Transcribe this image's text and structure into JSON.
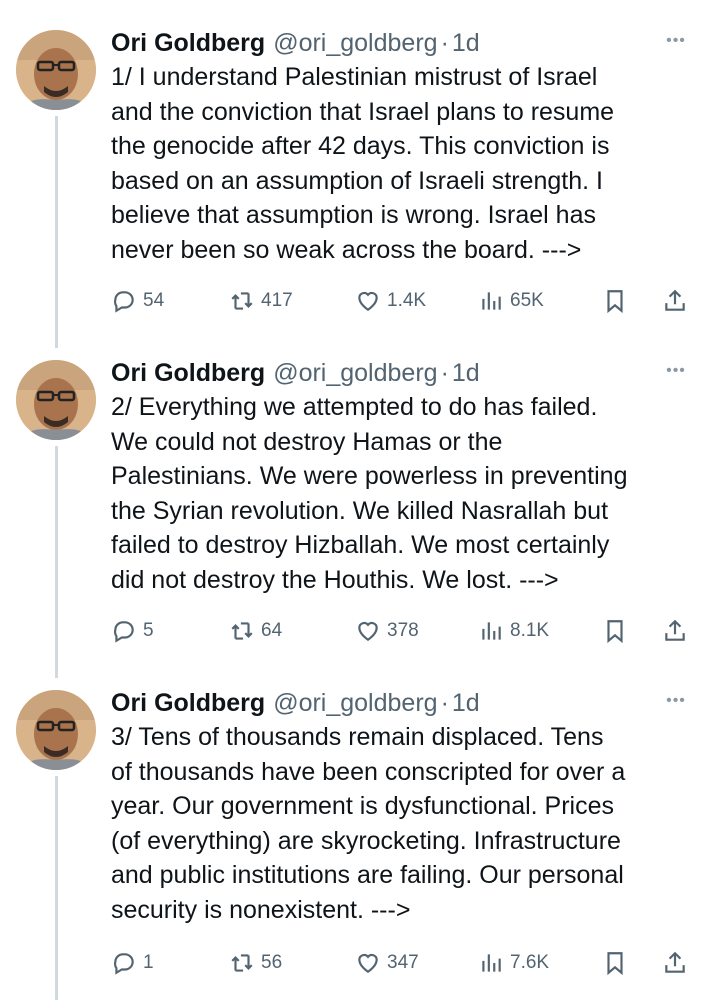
{
  "tweets": [
    {
      "name": "Ori Goldberg",
      "handle": "@ori_goldberg",
      "separator": "·",
      "time": "1d",
      "more": "•••",
      "lines": [
        "1/ I understand Palestinian mistrust of Israel",
        "and the conviction that Israel plans to resume",
        "the genocide after 42 days. This conviction is",
        "based on an assumption of Israeli strength. I",
        "believe that assumption is wrong. Israel has",
        "never been so weak across the board. --->"
      ],
      "replies": "54",
      "reposts": "417",
      "likes": "1.4K",
      "views": "65K"
    },
    {
      "name": "Ori Goldberg",
      "handle": "@ori_goldberg",
      "separator": "·",
      "time": "1d",
      "more": "•••",
      "lines": [
        "2/ Everything we attempted to do has failed.",
        "We could not destroy Hamas or the",
        "Palestinians. We were powerless in preventing",
        "the Syrian revolution. We killed Nasrallah but",
        "failed to destroy Hizballah. We most certainly",
        "did not destroy the Houthis. We lost. --->"
      ],
      "replies": "5",
      "reposts": "64",
      "likes": "378",
      "views": "8.1K"
    },
    {
      "name": "Ori Goldberg",
      "handle": "@ori_goldberg",
      "separator": "·",
      "time": "1d",
      "more": "•••",
      "lines": [
        "3/ Tens of thousands remain displaced. Tens",
        "of thousands have been conscripted for over a",
        "year. Our government is dysfunctional. Prices",
        "(of everything) are skyrocketing. Infrastructure",
        "and public institutions are failing. Our personal",
        "security is nonexistent. --->"
      ],
      "replies": "1",
      "reposts": "56",
      "likes": "347",
      "views": "7.6K"
    }
  ],
  "icons": {
    "avatar": "avatar-photo",
    "reply": "reply-icon",
    "repost": "repost-icon",
    "like": "heart-icon",
    "views": "views-icon",
    "bookmark": "bookmark-icon",
    "share": "share-icon",
    "more": "more-icon"
  },
  "colors": {
    "text": "#0f1419",
    "muted": "#536471",
    "thread_line": "#cfd9de"
  }
}
